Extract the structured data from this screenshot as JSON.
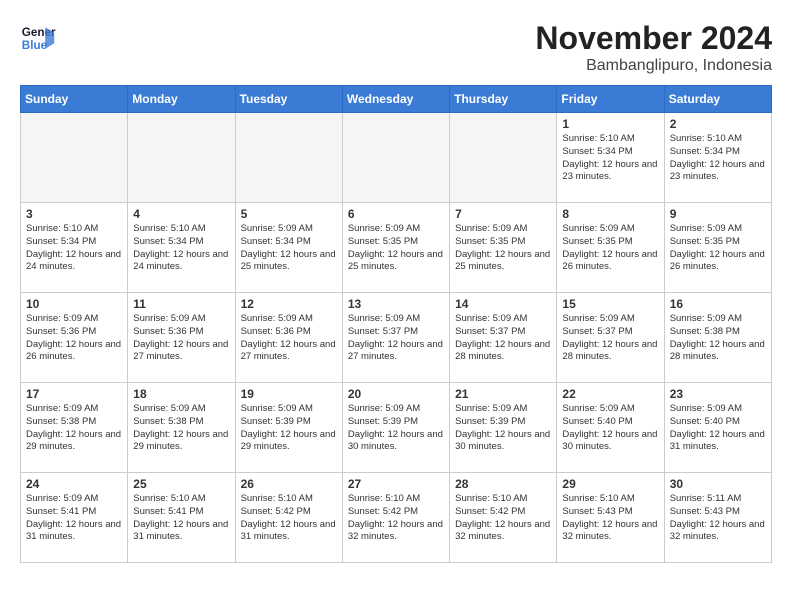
{
  "logo": {
    "line1": "General",
    "line2": "Blue"
  },
  "title": "November 2024",
  "subtitle": "Bambanglipuro, Indonesia",
  "headers": [
    "Sunday",
    "Monday",
    "Tuesday",
    "Wednesday",
    "Thursday",
    "Friday",
    "Saturday"
  ],
  "weeks": [
    [
      {
        "day": "",
        "info": ""
      },
      {
        "day": "",
        "info": ""
      },
      {
        "day": "",
        "info": ""
      },
      {
        "day": "",
        "info": ""
      },
      {
        "day": "",
        "info": ""
      },
      {
        "day": "1",
        "info": "Sunrise: 5:10 AM\nSunset: 5:34 PM\nDaylight: 12 hours and 23 minutes."
      },
      {
        "day": "2",
        "info": "Sunrise: 5:10 AM\nSunset: 5:34 PM\nDaylight: 12 hours and 23 minutes."
      }
    ],
    [
      {
        "day": "3",
        "info": "Sunrise: 5:10 AM\nSunset: 5:34 PM\nDaylight: 12 hours and 24 minutes."
      },
      {
        "day": "4",
        "info": "Sunrise: 5:10 AM\nSunset: 5:34 PM\nDaylight: 12 hours and 24 minutes."
      },
      {
        "day": "5",
        "info": "Sunrise: 5:09 AM\nSunset: 5:34 PM\nDaylight: 12 hours and 25 minutes."
      },
      {
        "day": "6",
        "info": "Sunrise: 5:09 AM\nSunset: 5:35 PM\nDaylight: 12 hours and 25 minutes."
      },
      {
        "day": "7",
        "info": "Sunrise: 5:09 AM\nSunset: 5:35 PM\nDaylight: 12 hours and 25 minutes."
      },
      {
        "day": "8",
        "info": "Sunrise: 5:09 AM\nSunset: 5:35 PM\nDaylight: 12 hours and 26 minutes."
      },
      {
        "day": "9",
        "info": "Sunrise: 5:09 AM\nSunset: 5:35 PM\nDaylight: 12 hours and 26 minutes."
      }
    ],
    [
      {
        "day": "10",
        "info": "Sunrise: 5:09 AM\nSunset: 5:36 PM\nDaylight: 12 hours and 26 minutes."
      },
      {
        "day": "11",
        "info": "Sunrise: 5:09 AM\nSunset: 5:36 PM\nDaylight: 12 hours and 27 minutes."
      },
      {
        "day": "12",
        "info": "Sunrise: 5:09 AM\nSunset: 5:36 PM\nDaylight: 12 hours and 27 minutes."
      },
      {
        "day": "13",
        "info": "Sunrise: 5:09 AM\nSunset: 5:37 PM\nDaylight: 12 hours and 27 minutes."
      },
      {
        "day": "14",
        "info": "Sunrise: 5:09 AM\nSunset: 5:37 PM\nDaylight: 12 hours and 28 minutes."
      },
      {
        "day": "15",
        "info": "Sunrise: 5:09 AM\nSunset: 5:37 PM\nDaylight: 12 hours and 28 minutes."
      },
      {
        "day": "16",
        "info": "Sunrise: 5:09 AM\nSunset: 5:38 PM\nDaylight: 12 hours and 28 minutes."
      }
    ],
    [
      {
        "day": "17",
        "info": "Sunrise: 5:09 AM\nSunset: 5:38 PM\nDaylight: 12 hours and 29 minutes."
      },
      {
        "day": "18",
        "info": "Sunrise: 5:09 AM\nSunset: 5:38 PM\nDaylight: 12 hours and 29 minutes."
      },
      {
        "day": "19",
        "info": "Sunrise: 5:09 AM\nSunset: 5:39 PM\nDaylight: 12 hours and 29 minutes."
      },
      {
        "day": "20",
        "info": "Sunrise: 5:09 AM\nSunset: 5:39 PM\nDaylight: 12 hours and 30 minutes."
      },
      {
        "day": "21",
        "info": "Sunrise: 5:09 AM\nSunset: 5:39 PM\nDaylight: 12 hours and 30 minutes."
      },
      {
        "day": "22",
        "info": "Sunrise: 5:09 AM\nSunset: 5:40 PM\nDaylight: 12 hours and 30 minutes."
      },
      {
        "day": "23",
        "info": "Sunrise: 5:09 AM\nSunset: 5:40 PM\nDaylight: 12 hours and 31 minutes."
      }
    ],
    [
      {
        "day": "24",
        "info": "Sunrise: 5:09 AM\nSunset: 5:41 PM\nDaylight: 12 hours and 31 minutes."
      },
      {
        "day": "25",
        "info": "Sunrise: 5:10 AM\nSunset: 5:41 PM\nDaylight: 12 hours and 31 minutes."
      },
      {
        "day": "26",
        "info": "Sunrise: 5:10 AM\nSunset: 5:42 PM\nDaylight: 12 hours and 31 minutes."
      },
      {
        "day": "27",
        "info": "Sunrise: 5:10 AM\nSunset: 5:42 PM\nDaylight: 12 hours and 32 minutes."
      },
      {
        "day": "28",
        "info": "Sunrise: 5:10 AM\nSunset: 5:42 PM\nDaylight: 12 hours and 32 minutes."
      },
      {
        "day": "29",
        "info": "Sunrise: 5:10 AM\nSunset: 5:43 PM\nDaylight: 12 hours and 32 minutes."
      },
      {
        "day": "30",
        "info": "Sunrise: 5:11 AM\nSunset: 5:43 PM\nDaylight: 12 hours and 32 minutes."
      }
    ]
  ]
}
